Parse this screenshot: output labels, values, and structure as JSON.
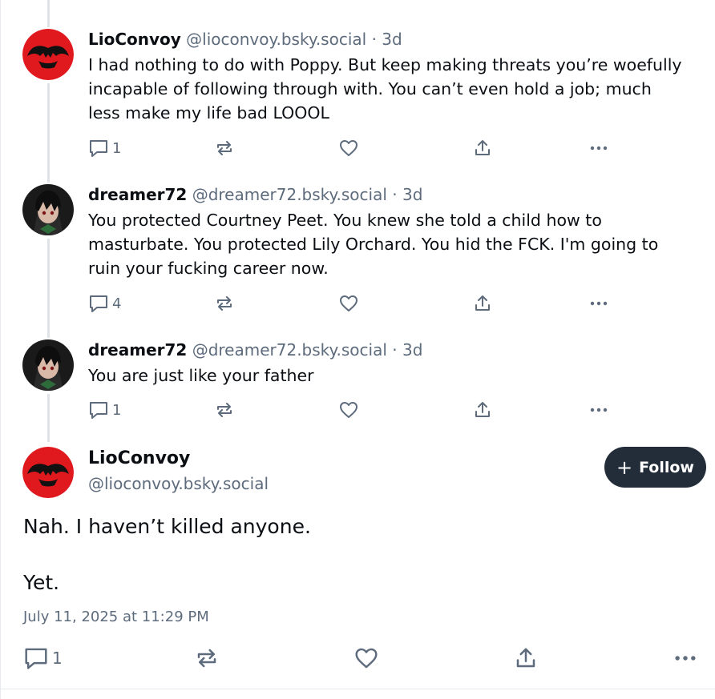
{
  "posts": [
    {
      "author": "LioConvoy",
      "handle": "@lioconvoy.bsky.social",
      "separator": "·",
      "age": "3d",
      "text": "I had nothing to do with Poppy. But keep making threats you’re woefully incapable of following through with. You can’t even hold a job; much less make my life bad LOOOL",
      "reply_count": "1",
      "avatar_icon": "thundercats-logo-icon"
    },
    {
      "author": "dreamer72",
      "handle": "@dreamer72.bsky.social",
      "separator": "·",
      "age": "3d",
      "text": "You protected Courtney Peet. You knew she told a child how to masturbate. You protected Lily Orchard. You hid the FCK. I'm going to ruin your fucking career now.",
      "reply_count": "4",
      "avatar_icon": "anime-character-avatar"
    },
    {
      "author": "dreamer72",
      "handle": "@dreamer72.bsky.social",
      "separator": "·",
      "age": "3d",
      "text": "You are just like your father",
      "reply_count": "1",
      "avatar_icon": "anime-character-avatar"
    }
  ],
  "focused": {
    "author": "LioConvoy",
    "handle": "@lioconvoy.bsky.social",
    "follow_label": "Follow",
    "follow_icon": "+",
    "text_line1": "Nah. I haven’t killed anyone.",
    "text_line2": "Yet.",
    "date": "July 11, 2025 at 11:29 PM",
    "reply_count": "1"
  },
  "colors": {
    "text": "#0b0f14",
    "muted": "#5d6b7c",
    "follow_bg": "#232d3a",
    "thread_line": "#dfe3e8",
    "logo_red": "#e0191f"
  }
}
